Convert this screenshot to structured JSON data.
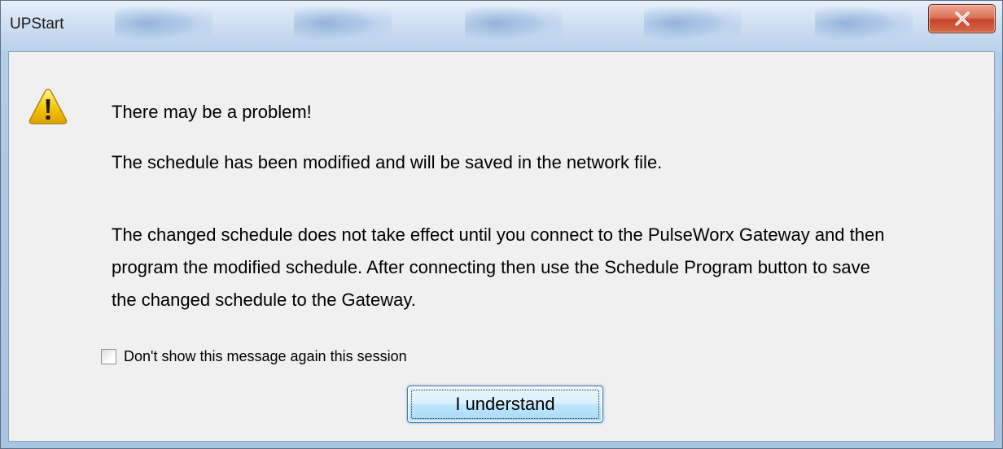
{
  "window": {
    "title": "UPStart"
  },
  "titlebar": {
    "close_icon": "close-x-icon",
    "close_button_color": "#c4452d"
  },
  "dialog": {
    "icon": "warning-triangle-icon",
    "headline": "There may be a problem!",
    "paragraph1": "The schedule has been modified and will be saved in the network file.",
    "paragraph2": "The changed schedule does not take effect until you connect to the PulseWorx Gateway and then program the modified schedule. After connecting then use the Schedule Program button to save the changed schedule to the Gateway.",
    "checkbox": {
      "label": "Don't show this message again this session",
      "checked": false
    },
    "primary_button": {
      "label": "I understand"
    }
  },
  "colors": {
    "warning_fill": "#f5c400",
    "button_border": "#3c7fb1",
    "client_background": "#f0f0f0"
  }
}
